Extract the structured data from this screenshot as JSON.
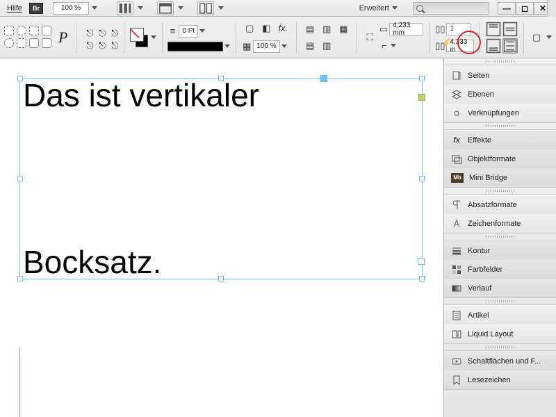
{
  "menubar": {
    "help": "Hilfe",
    "br": "Br",
    "zoom": "100 %",
    "erweitert": "Erweitert"
  },
  "toolbar": {
    "pt_field": "0 Pt",
    "opacity": "100 %",
    "dim1": "4,233 mm",
    "cols": "1",
    "dim2": "4,233 m"
  },
  "canvas": {
    "line1": "Das ist vertikaler",
    "line2": "Bocksatz."
  },
  "panels": {
    "seiten": "Seiten",
    "ebenen": "Ebenen",
    "verkn": "Verknüpfungen",
    "effekte": "Effekte",
    "objektformate": "Objektformate",
    "minibridge": "Mini Bridge",
    "absatzformate": "Absatzformate",
    "zeichenformate": "Zeichenformate",
    "kontur": "Kontur",
    "farbfelder": "Farbfelder",
    "verlauf": "Verlauf",
    "artikel": "Artikel",
    "liquid": "Liquid Layout",
    "schaltflaechen": "Schaltflächen und F...",
    "lesezeichen": "Lesezeichen"
  }
}
